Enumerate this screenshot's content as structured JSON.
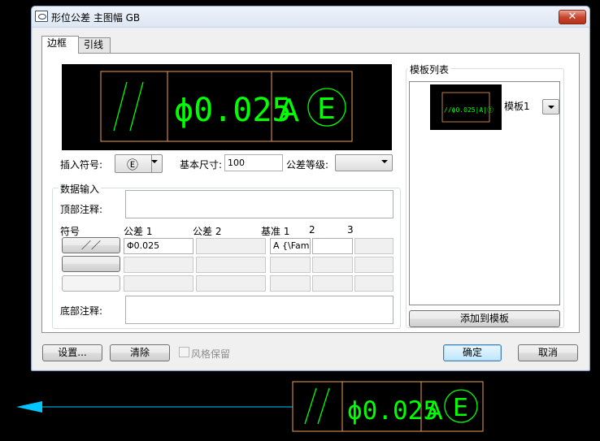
{
  "window": {
    "title": "形位公差 主图幅 GB",
    "close_glyph": "✕"
  },
  "tabs": [
    {
      "label": "边框"
    },
    {
      "label": "引线"
    }
  ],
  "preview": {
    "parallel_symbol": "//",
    "tolerance_text": "ϕ0.025",
    "datum": "A",
    "modifier": "E",
    "frame_color": "#f0a050",
    "symbol_color": "#00ff00"
  },
  "form": {
    "insert_symbol_label": "插入符号:",
    "insert_symbol_value": "Ⓔ",
    "basic_size_label": "基本尺寸:",
    "basic_size_value": "100",
    "tolerance_grade_label": "公差等级:",
    "data_input_label": "数据输入",
    "top_note_label": "顶部注释:",
    "bottom_note_label": "底部注释:",
    "symbol_col_label": "符号",
    "tol1_label": "公差 1",
    "tol2_label": "公差 2",
    "datum1_label": "基准 1",
    "datum2_label": "2",
    "datum3_label": "3",
    "row1_symbol": "／／",
    "row1_tol1": "Φ0.025",
    "row1_datum1": "A {\\Famg"
  },
  "templates": {
    "title": "模板列表",
    "item_label": "模板1",
    "thumb_text": "//ϕ0.025|A|Ⓔ",
    "add_button": "添加到模板"
  },
  "bottom_bar": {
    "settings_button": "设置...",
    "clear_button": "清除",
    "keep_style_label": "风格保留",
    "ok_button": "确定",
    "cancel_button": "取消"
  },
  "cad": {
    "leader_color": "#00c8ff",
    "tolerance_text": "ϕ0.025",
    "parallel_symbol": "//",
    "datum": "A",
    "modifier": "E"
  }
}
